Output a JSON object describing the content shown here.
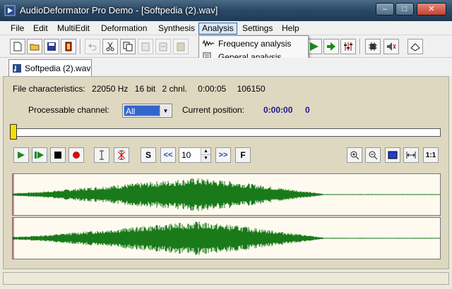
{
  "window": {
    "title": "AudioDeformator Pro Demo - [Softpedia (2).wav]",
    "minimize_label": "–",
    "maximize_label": "□",
    "close_label": "✕"
  },
  "menu": [
    {
      "label": "File"
    },
    {
      "label": "Edit"
    },
    {
      "label": "MultiEdit"
    },
    {
      "label": "Deformation"
    },
    {
      "label": "Synthesis"
    },
    {
      "label": "Analysis"
    },
    {
      "label": "Settings"
    },
    {
      "label": "Help"
    }
  ],
  "analysis_menu": {
    "items": [
      {
        "label": "Frequency analysis",
        "icon": "waveform-icon"
      },
      {
        "label": "General analysis",
        "icon": "document-analysis-icon"
      }
    ]
  },
  "tab": {
    "label": "Softpedia (2).wav"
  },
  "file_info": {
    "label": "File characteristics:",
    "sample_rate": "22050 Hz",
    "bit_depth": "16 bit",
    "channels": "2 chnl.",
    "duration": "0:00:05",
    "samples": "106150"
  },
  "channel": {
    "label": "Processable channel:",
    "value": "All"
  },
  "position": {
    "label": "Current position:",
    "time": "0:00:00",
    "sample": "0"
  },
  "controls": {
    "s_label": "S",
    "rewind_label": "<<",
    "step_value": "10",
    "forward_label": ">>",
    "f_label": "F",
    "ratio_label": "1:1"
  },
  "colors": {
    "waveform": "#1a7a1a",
    "selection": "#3366cc",
    "accent": "#f5e000"
  }
}
